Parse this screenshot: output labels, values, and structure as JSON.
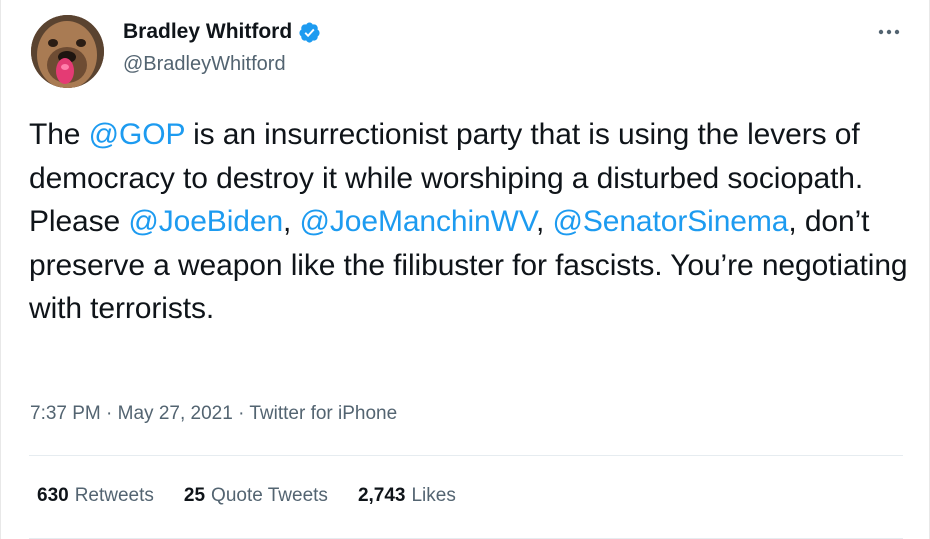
{
  "user": {
    "display_name": "Bradley Whitford",
    "handle": "@BradleyWhitford",
    "verified": true,
    "avatar_icon": "dog-with-toy-avatar"
  },
  "tweet": {
    "segments": [
      {
        "text": "The ",
        "type": "text"
      },
      {
        "text": "@GOP",
        "type": "mention"
      },
      {
        "text": " is an insurrectionist party that is using the levers of democracy to destroy it while worshiping a disturbed sociopath. Please ",
        "type": "text"
      },
      {
        "text": "@JoeBiden",
        "type": "mention"
      },
      {
        "text": ", ",
        "type": "text"
      },
      {
        "text": "@JoeManchinWV",
        "type": "mention"
      },
      {
        "text": ", ",
        "type": "text"
      },
      {
        "text": "@SenatorSinema",
        "type": "mention"
      },
      {
        "text": ", don’t preserve a weapon like the filibuster for fascists. You’re negotiating with terrorists.",
        "type": "text"
      }
    ]
  },
  "meta": {
    "time": "7:37 PM",
    "separator": " · ",
    "date": "May 27, 2021",
    "source": "Twitter for iPhone"
  },
  "stats": {
    "retweets_count": "630",
    "retweets_label": "Retweets",
    "quote_tweets_count": "25",
    "quote_tweets_label": "Quote Tweets",
    "likes_count": "2,743",
    "likes_label": "Likes"
  },
  "colors": {
    "mention": "#1d9bf0",
    "verified": "#1d9bf0",
    "secondary_text": "#536471",
    "primary_text": "#0f1419"
  },
  "icons": {
    "more": "more-horizontal-icon",
    "verified": "verified-badge-icon"
  }
}
